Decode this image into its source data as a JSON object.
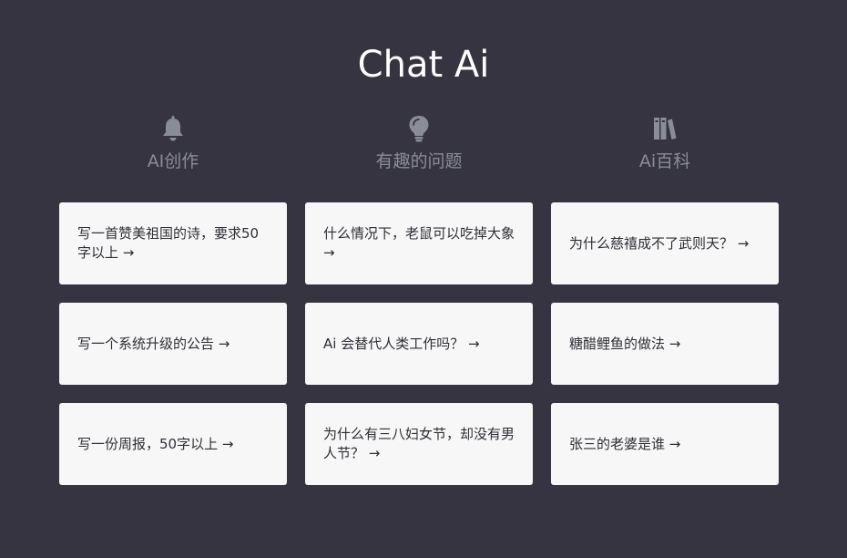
{
  "header": {
    "title": "Chat Ai"
  },
  "columns": [
    {
      "heading": "AI创作",
      "icon": "bell-icon",
      "cards": [
        "写一首赞美祖国的诗，要求50字以上 →",
        "写一个系统升级的公告 →",
        "写一份周报，50字以上 →"
      ]
    },
    {
      "heading": "有趣的问题",
      "icon": "lightbulb-icon",
      "cards": [
        "什么情况下，老鼠可以吃掉大象 →",
        "Ai 会替代人类工作吗？ →",
        "为什么有三八妇女节，却没有男人节？ →"
      ]
    },
    {
      "heading": "Ai百科",
      "icon": "books-icon",
      "cards": [
        "为什么慈禧成不了武则天？ →",
        "糖醋鲤鱼的做法 →",
        "张三的老婆是谁 →"
      ]
    }
  ],
  "colors": {
    "background": "#353440",
    "card": "#f7f7f7",
    "heading": "#8a8d99",
    "icon": "#8a8d99",
    "title": "#ffffff"
  }
}
